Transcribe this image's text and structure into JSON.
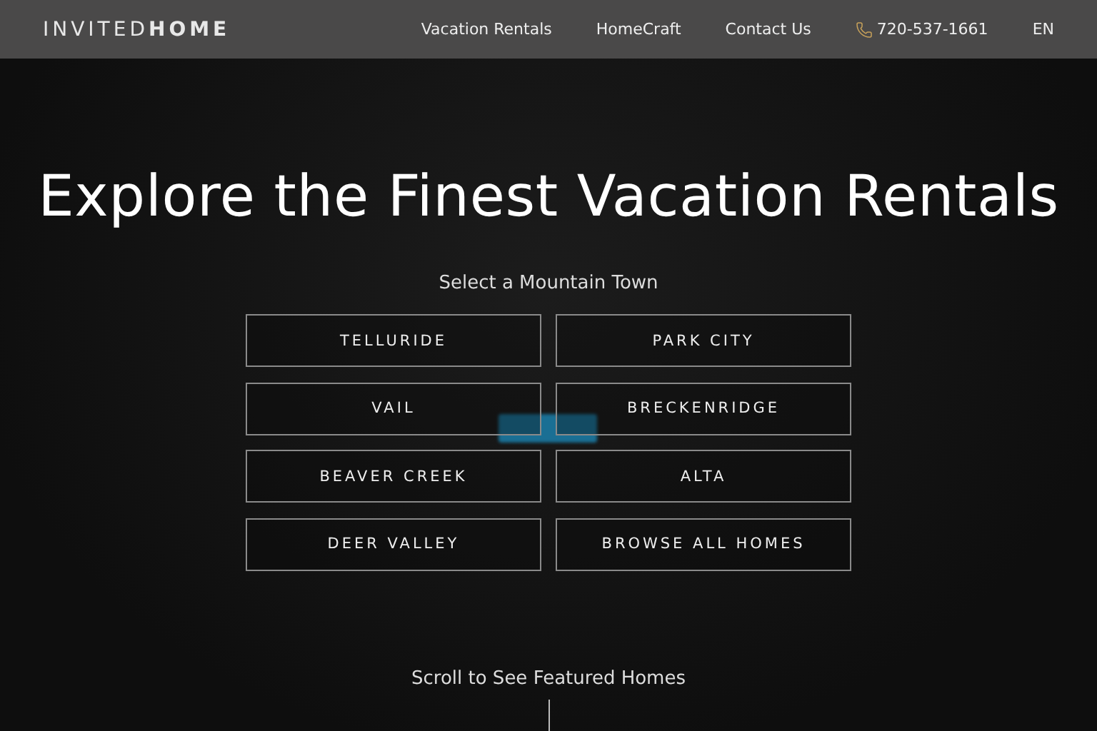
{
  "header": {
    "logo": "INVITED**HOME**",
    "nav": [
      "Vacation Rentals",
      "HomeCraft",
      "Contact Us"
    ],
    "phone": "720-537-1661",
    "language": "EN"
  },
  "hero": {
    "title": "Explore the Finest Vacation Rentals",
    "subtitle": "Select a Mountain Town",
    "towns": [
      "TELLURIDE",
      "PARK CITY",
      "VAIL",
      "BRECKENRIDGE",
      "BEAVER CREEK",
      "ALTA",
      "DEER VALLEY",
      "BROWSE ALL HOMES"
    ],
    "scroll_hint": "Scroll to See Featured Homes"
  }
}
